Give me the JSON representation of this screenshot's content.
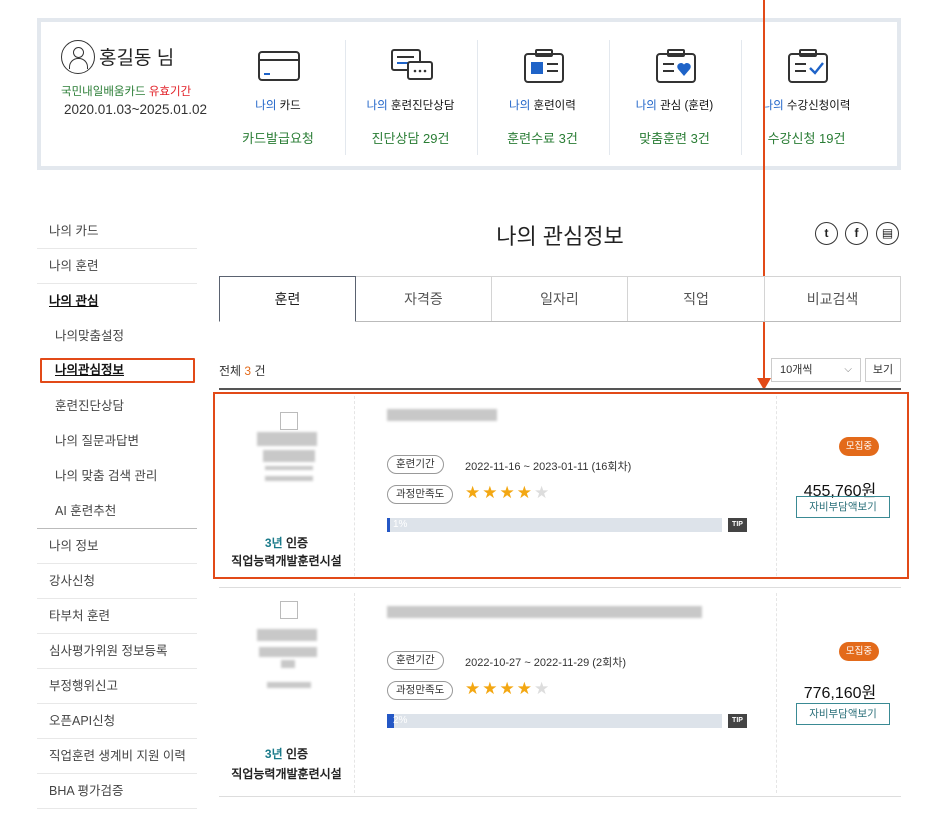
{
  "summary": {
    "user_name": "홍길동 님",
    "card_label": "국민내일배움카드",
    "card_label_highlight": "유효기간",
    "card_dates": "2020.01.03~2025.01.02",
    "columns": [
      {
        "prefix": "나의",
        "label": " 카드",
        "value_text": "카드발급요청",
        "icon": "card-icon"
      },
      {
        "prefix": "나의",
        "label": " 훈련진단상담",
        "value_text": "진단상담 29건",
        "icon": "consult-chat-icon"
      },
      {
        "prefix": "나의",
        "label": " 훈련이력",
        "value_text": "훈련수료 3건",
        "icon": "training-history-icon"
      },
      {
        "prefix": "나의",
        "label": " 관심 (훈련)",
        "value_text": "맞춤훈련 3건",
        "icon": "heart-clipboard-icon"
      },
      {
        "prefix": "나의",
        "label": " 수강신청이력",
        "value_text": "수강신청 19건",
        "icon": "check-clipboard-icon"
      }
    ]
  },
  "sidebar": {
    "items": [
      {
        "label": "나의 카드"
      },
      {
        "label": "나의 훈련"
      },
      {
        "label": "나의 관심"
      },
      {
        "label": "나의맞춤설정"
      },
      {
        "label": "나의관심정보"
      },
      {
        "label": "훈련진단상담"
      },
      {
        "label": "나의 질문과답변"
      },
      {
        "label": "나의 맞춤 검색 관리"
      },
      {
        "label": "AI 훈련추천"
      },
      {
        "label": "나의 정보"
      },
      {
        "label": "강사신청"
      },
      {
        "label": "타부처 훈련"
      },
      {
        "label": "심사평가위원 정보등록"
      },
      {
        "label": "부정행위신고"
      },
      {
        "label": "오픈API신청"
      },
      {
        "label": "직업훈련 생계비 지원 이력"
      },
      {
        "label": "BHA 평가검증"
      }
    ]
  },
  "main": {
    "title": "나의 관심정보",
    "share": {
      "twitter": "t",
      "facebook": "f",
      "print": "▤"
    },
    "tabs": [
      "훈련",
      "자격증",
      "일자리",
      "직업",
      "비교검색"
    ],
    "total_prefix": "전체 ",
    "total_count": "3",
    "total_suffix": " 건",
    "per_page": "10개씩",
    "view_button": "보기",
    "items": [
      {
        "cert_years": "3년",
        "cert_text": " 인증",
        "facility": "직업능력개발훈련시설",
        "period_label": "훈련기간",
        "period": "2022-11-16 ~ 2023-01-11 (16회차)",
        "satisfaction_label": "과정만족도",
        "rating": 4,
        "max_rating": 5,
        "progress_text": "1%",
        "progress": 0.01,
        "tip": "TIP",
        "status": "모집중",
        "price": "455,760원",
        "cost_button": "자비부담액보기"
      },
      {
        "cert_years": "3년",
        "cert_text": " 인증",
        "facility": "직업능력개발훈련시설",
        "period_label": "훈련기간",
        "period": "2022-10-27 ~ 2022-11-29 (2회차)",
        "satisfaction_label": "과정만족도",
        "rating": 4,
        "max_rating": 5,
        "progress_text": "2%",
        "progress": 0.02,
        "tip": "TIP",
        "status": "모집중",
        "price": "776,160원",
        "cost_button": "자비부담액보기"
      }
    ]
  },
  "colors": {
    "accent_green": "#2a7d35",
    "accent_blue": "#1e63c8",
    "annotation_red": "#e24a18",
    "status_orange": "#e36a1a"
  }
}
